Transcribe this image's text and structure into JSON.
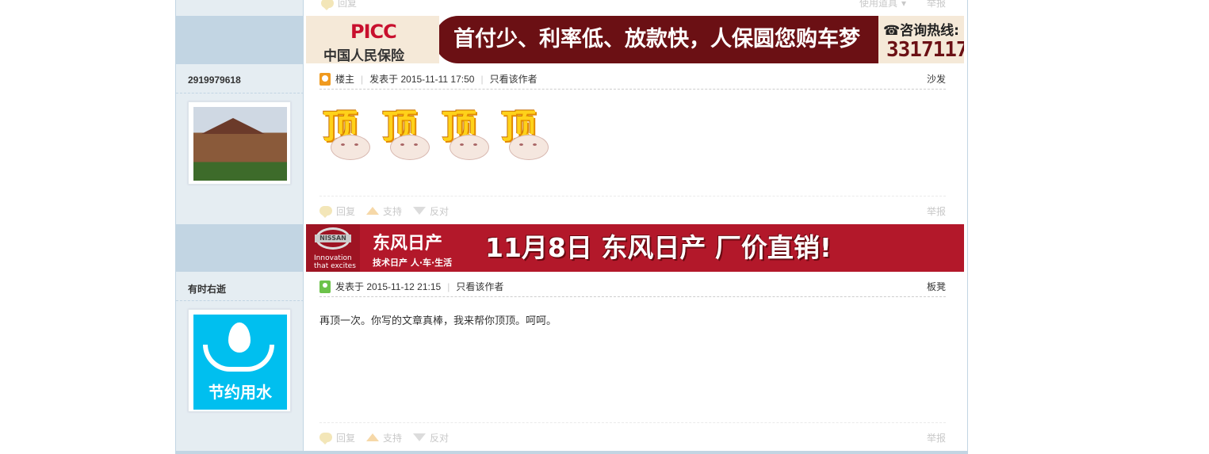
{
  "top_remnant": {
    "reply": "回复",
    "tools": "使用道具",
    "report": "举报"
  },
  "ads": {
    "picc": {
      "logo": "PICC",
      "company": "中国人民保险",
      "slogan": "首付少、利率低、放款快，人保圆您购车梦",
      "hotline_label": "☎咨询热线:",
      "hotline": "3317117"
    },
    "nissan": {
      "emblem": "NISSAN",
      "tagline": "Innovation that excites",
      "brand": "东风日产",
      "sub": "技术日产 人·车·生活",
      "slogan": "11月8日 东风日产 厂价直销!"
    }
  },
  "posts": [
    {
      "username": "2919979618",
      "is_host": true,
      "host_label": "楼主",
      "posted": "发表于 2015-11-11 17:50",
      "only_author": "只看该作者",
      "floor": "沙发",
      "ding_chars": [
        "顶",
        "顶",
        "顶",
        "顶"
      ],
      "actions": {
        "reply": "回复",
        "support": "支持",
        "oppose": "反对",
        "report": "举报"
      }
    },
    {
      "username": "有时右逝",
      "is_host": false,
      "posted": "发表于 2015-11-12 21:15",
      "only_author": "只看该作者",
      "floor": "板凳",
      "avatar_text": "节约用水",
      "message": "再顶一次。你写的文章真棒，我来帮你顶顶。呵呵。",
      "actions": {
        "reply": "回复",
        "support": "支持",
        "oppose": "反对",
        "report": "举报"
      }
    }
  ],
  "colors": {
    "sidebar": "#e5edf2",
    "ad_sidebar": "#c2d5e3",
    "border": "#c2d5e3",
    "picc_red": "#6b1014",
    "nissan_red": "#b3182a"
  }
}
